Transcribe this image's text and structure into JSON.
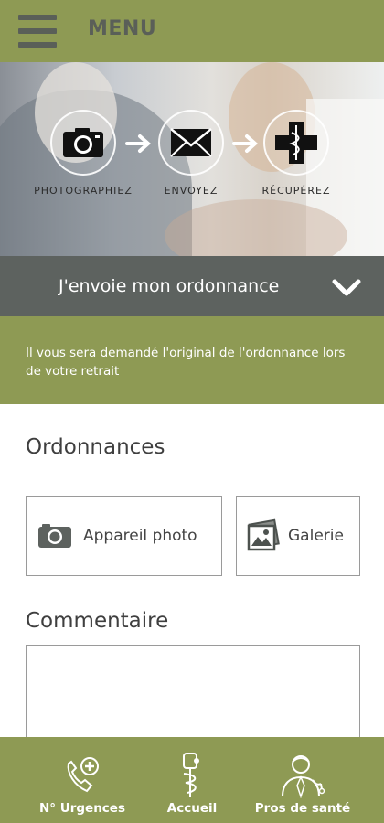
{
  "header": {
    "menu_label": "MENU"
  },
  "hero": {
    "steps": [
      {
        "label": "PHOTOGRAPHIEZ",
        "icon": "camera-icon"
      },
      {
        "label": "ENVOYEZ",
        "icon": "envelope-icon"
      },
      {
        "label": "RÉCUPÉREZ",
        "icon": "pharmacy-cross-icon"
      }
    ]
  },
  "accordion": {
    "title": "J'envoie mon ordonnance",
    "icon": "chevron-down-icon"
  },
  "notice": {
    "text": "Il vous sera demandé l'original de l'ordonnance lors de votre retrait"
  },
  "prescriptions": {
    "title": "Ordonnances",
    "camera_button": "Appareil photo",
    "gallery_button": "Galerie"
  },
  "comment": {
    "title": "Commentaire",
    "value": ""
  },
  "bottom_nav": {
    "items": [
      {
        "label": "N° Urgences",
        "icon": "emergency-phone-icon"
      },
      {
        "label": "Accueil",
        "icon": "home-caduceus-icon"
      },
      {
        "label": "Pros de santé",
        "icon": "doctor-icon"
      }
    ]
  },
  "colors": {
    "brand_green": "#8e9a54",
    "dark_grey": "#5d625f",
    "text": "#3f3f3f"
  }
}
